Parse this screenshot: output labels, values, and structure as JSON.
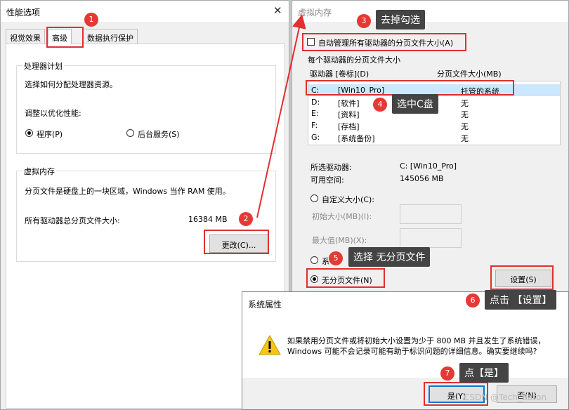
{
  "perf_window": {
    "title": "性能选项",
    "tabs": [
      "视觉效果",
      "高级",
      "数据执行保护"
    ],
    "processor_group": {
      "title": "处理器计划",
      "desc": "选择如何分配处理器资源。",
      "adjust_label": "调整以优化性能:",
      "option_programs": "程序(P)",
      "option_services": "后台服务(S)"
    },
    "vm_group": {
      "title": "虚拟内存",
      "desc": "分页文件是硬盘上的一块区域，Windows 当作 RAM 使用。",
      "total_label": "所有驱动器总分页文件大小:",
      "total_value": "16384 MB",
      "change_button": "更改(C)..."
    }
  },
  "vm_window": {
    "title": "虚拟内存",
    "auto_manage": "自动管理所有驱动器的分页文件大小(A)",
    "auto_manage_checked": false,
    "per_drive_label": "每个驱动器的分页文件大小",
    "col_drive": "驱动器 [卷标](D)",
    "col_size": "分页文件大小(MB)",
    "drives": [
      {
        "letter": "C:",
        "label": "[Win10_Pro]",
        "size": "托管的系统"
      },
      {
        "letter": "D:",
        "label": "[软件]",
        "size": "无"
      },
      {
        "letter": "E:",
        "label": "[资料]",
        "size": "无"
      },
      {
        "letter": "F:",
        "label": "[存档]",
        "size": "无"
      },
      {
        "letter": "G:",
        "label": "[系统备份]",
        "size": "无"
      }
    ],
    "selected_drive_label": "所选驱动器:",
    "selected_drive_value": "C:  [Win10_Pro]",
    "free_space_label": "可用空间:",
    "free_space_value": "145056 MB",
    "custom_size": "自定义大小(C):",
    "initial_size": "初始大小(MB)(I):",
    "max_size": "最大值(MB)(X):",
    "system_managed_partial": "系",
    "no_paging": "无分页文件(N)",
    "set_button": "设置(S)"
  },
  "dialog": {
    "title": "系统属性",
    "message_line1": "如果禁用分页文件或将初始大小设置为少于 800 MB 并且发生了系统错误，",
    "message_line2": "Windows 可能不会记录可能有助于标识问题的详细信息。确实要继续吗?",
    "yes_button": "是(Y)",
    "no_button": "否(N)"
  },
  "annotations": [
    {
      "num": "1",
      "text": ""
    },
    {
      "num": "2",
      "text": ""
    },
    {
      "num": "3",
      "text": "去掉勾选"
    },
    {
      "num": "4",
      "text": "选中C盘"
    },
    {
      "num": "5",
      "text": "选择 无分页文件"
    },
    {
      "num": "6",
      "text": "点击 【设置】"
    },
    {
      "num": "7",
      "text": "点【是】"
    }
  ],
  "watermark": "CSDN @Tech_Baron",
  "colors": {
    "accent_red": "#e03030",
    "selection": "#cce8ff",
    "tooltip_bg": "#444444"
  }
}
